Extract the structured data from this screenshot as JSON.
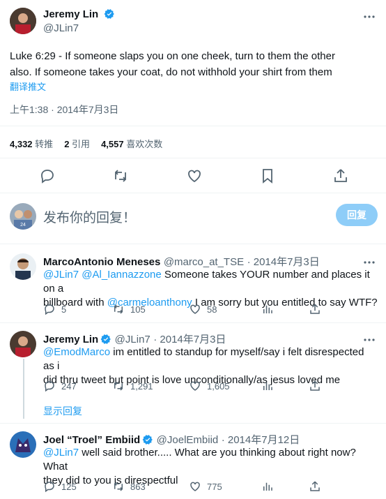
{
  "main_tweet": {
    "author_name": "Jeremy Lin",
    "handle": "@JLin7",
    "text_line1": "Luke 6:29 - If someone slaps you on one cheek, turn to them the other",
    "text_line2": "also. If someone takes your coat, do not withhold your shirt from them",
    "translate_label": "翻译推文",
    "timestamp": "上午1:38 · 2014年7月3日",
    "stats": [
      {
        "count": "4,332",
        "label": "转推"
      },
      {
        "count": "2",
        "label": "引用"
      },
      {
        "count": "4,557",
        "label": "喜欢次数"
      }
    ]
  },
  "compose": {
    "placeholder": "发布你的回复！",
    "reply_button": "回复"
  },
  "replies": [
    {
      "author_name": "MarcoAntonio Meneses",
      "handle": "@marco_at_TSE",
      "date": "· 2014年7月3日",
      "mention1": "@JLin7",
      "mention2": "@Al_Iannazzone",
      "text_a": " Someone takes YOUR number and places it on a",
      "text_b": "billboard with ",
      "mention3": "@carmeloanthony",
      "text_c": " I am sorry but you entitled to say WTF?",
      "replies": "5",
      "retweets": "105",
      "likes": "58"
    },
    {
      "author_name": "Jeremy Lin",
      "handle": "@JLin7",
      "date": "· 2014年7月3日",
      "mention1": "@EmodMarco",
      "text_a": " im entitled to standup for myself/say i felt disrespected as i",
      "text_b": "did thru tweet but point is love unconditionally/as jesus loved me",
      "replies": "247",
      "retweets": "1,291",
      "likes": "1,605",
      "show_replies": "显示回复"
    },
    {
      "author_name": "Joel “Troel” Embiid",
      "handle": "@JoelEmbiid",
      "date": "· 2014年7月12日",
      "mention1": "@JLin7",
      "text_a": " well said brother..... What are you thinking about right now? What",
      "text_b": "they did to you is direspectful",
      "replies": "125",
      "retweets": "863",
      "likes": "775"
    }
  ],
  "icons": [
    "verified-badge-icon",
    "more-icon",
    "reply-icon",
    "retweet-icon",
    "like-icon",
    "bookmark-icon",
    "share-icon",
    "analytics-icon"
  ],
  "colors": {
    "accent": "#1d9bf0",
    "muted": "#536471",
    "reply_button_bg": "#8ecdf8"
  }
}
